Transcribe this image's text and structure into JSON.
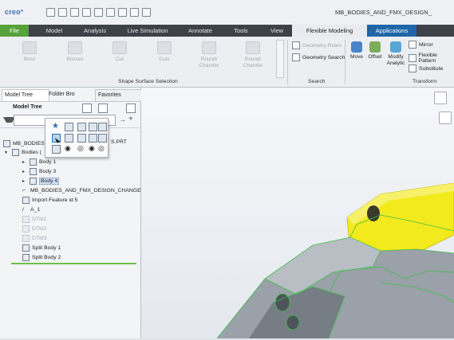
{
  "app": {
    "logo": "creo°",
    "window_title": "MB_BODIES_AND_FMX_DESIGN_"
  },
  "tabs": [
    {
      "label": "File"
    },
    {
      "label": "Model"
    },
    {
      "label": "Analysis"
    },
    {
      "label": "Live Simulation"
    },
    {
      "label": "Annotate"
    },
    {
      "label": "Tools"
    },
    {
      "label": "View"
    },
    {
      "label": "Flexible Modeling"
    },
    {
      "label": "Applications"
    }
  ],
  "ribbon": {
    "shape_surface": {
      "buttons": [
        "Boss",
        "Bosses",
        "Cut",
        "Cuts",
        "Round/\nChamfer",
        "Round/\nChamfer"
      ],
      "label": "Shape Surface Selection"
    },
    "search": {
      "geometry_rules": "Geometry Rules",
      "geometry_search": "Geometry Search",
      "label": "Search"
    },
    "transform": {
      "move": "Move",
      "offset": "Offset",
      "modify": "Modify\nAnalytic",
      "mirror": "Mirror",
      "flexible_pattern": "Flexible Pattern",
      "substitute": "Substitute",
      "label": "Transform"
    }
  },
  "panel": {
    "tabs": {
      "model_tree": "Model Tree",
      "folder": "Folder Bro",
      "favorites": "Favorites"
    },
    "header": "Model Tree",
    "root_suffix": "S.PRT",
    "items": [
      {
        "label": "MB_BODIES"
      },
      {
        "label": "Bodies ("
      },
      {
        "label": "Body 1"
      },
      {
        "label": "Body 3"
      },
      {
        "label": "Body 4"
      },
      {
        "label": "MB_BODIES_AND_FMX_DESIGN_CHANGE"
      },
      {
        "label": "Import Feature id 5"
      },
      {
        "label": "A_1"
      },
      {
        "label": "DTM1"
      },
      {
        "label": "DTM2"
      },
      {
        "label": "DTM3"
      },
      {
        "label": "Split Body 1"
      },
      {
        "label": "Split Body 2"
      }
    ]
  },
  "colors": {
    "file_tab": "#57a23b",
    "flex_tab": "#e8ebef",
    "apps_tab": "#1f66a8",
    "body_yellow": "#f2ea1c",
    "body_gray": "#9aa1a8",
    "edge_green": "#3fbf4a"
  }
}
